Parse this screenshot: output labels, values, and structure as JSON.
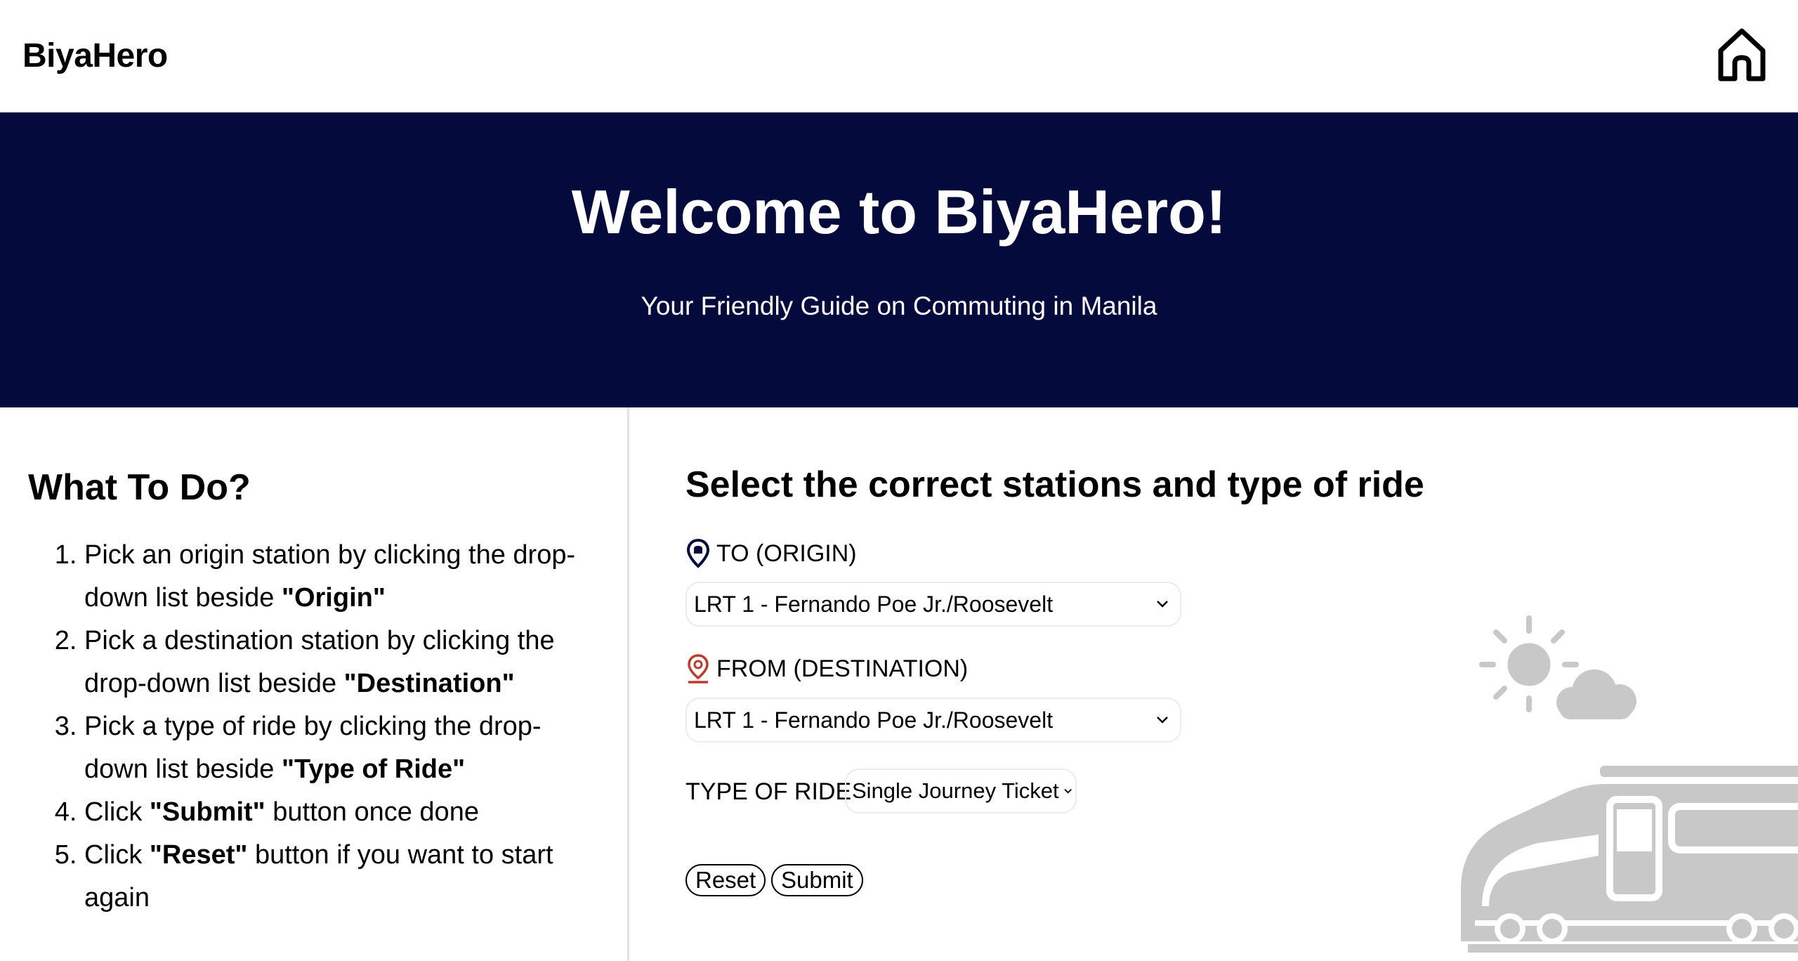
{
  "header": {
    "brand": "BiyaHero"
  },
  "hero": {
    "title": "Welcome to BiyaHero!",
    "subtitle": "Your Friendly Guide on Commuting in Manila"
  },
  "instructions": {
    "heading": "What To Do?",
    "steps": [
      {
        "text": "Pick an origin station by clicking the drop-down list beside ",
        "bold": "\"Origin\""
      },
      {
        "text": "Pick a destination station by clicking the drop-down list beside ",
        "bold": "\"Destination\""
      },
      {
        "text": "Pick a type of ride by clicking the drop-down list beside ",
        "bold": "\"Type of Ride\""
      },
      {
        "pre": "Click ",
        "bold": "\"Submit\"",
        "post": " button once done"
      },
      {
        "pre": "Click ",
        "bold": "\"Reset\"",
        "post": " button if you want to start again"
      }
    ]
  },
  "form": {
    "heading": "Select the correct stations and type of ride",
    "origin_label": "TO (ORIGIN)",
    "origin_value": "LRT 1 - Fernando Poe Jr./Roosevelt",
    "destination_label": "FROM (DESTINATION)",
    "destination_value": "LRT 1 - Fernando Poe Jr./Roosevelt",
    "ride_label": "TYPE OF RIDE",
    "ride_value": "Single Journey Ticket",
    "reset_label": "Reset",
    "submit_label": "Submit"
  },
  "colors": {
    "hero_bg": "#050a3d",
    "origin_pin": "#050a3d",
    "destination_pin": "#c0392b",
    "illustration": "#c8c8c8"
  }
}
